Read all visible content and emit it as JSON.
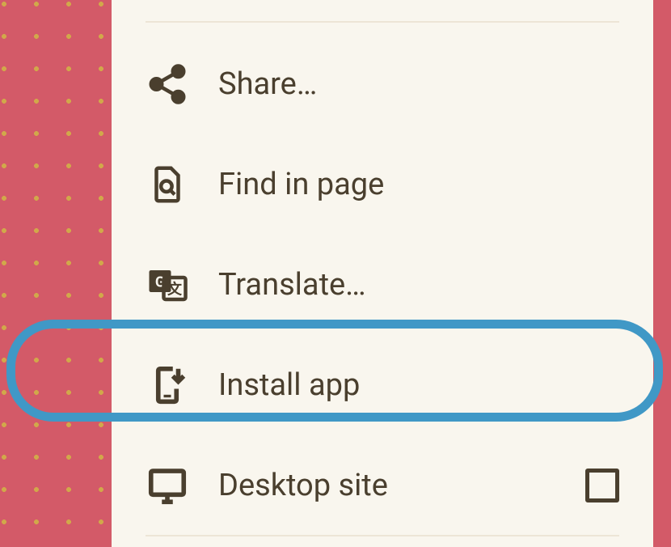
{
  "menu": {
    "items": [
      {
        "label": "Share…",
        "icon": "share-icon"
      },
      {
        "label": "Find in page",
        "icon": "find-in-page-icon"
      },
      {
        "label": "Translate…",
        "icon": "translate-icon"
      },
      {
        "label": "Install app",
        "icon": "install-app-icon"
      },
      {
        "label": "Desktop site",
        "icon": "desktop-icon",
        "checkbox": true,
        "checked": false
      }
    ],
    "highlighted_index": 3
  },
  "colors": {
    "background": "#d35a68",
    "dots": "#d1a84a",
    "panel": "#f9f6ee",
    "text": "#4a3f2e",
    "highlight": "#4098c6"
  }
}
